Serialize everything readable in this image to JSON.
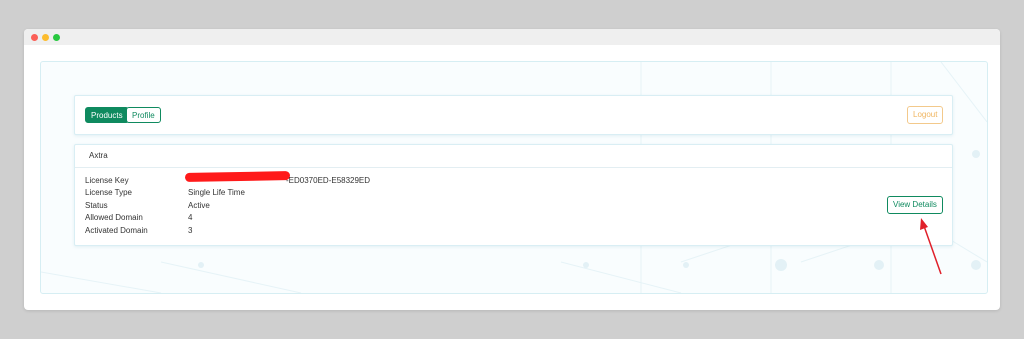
{
  "nav": {
    "products_label": "Products",
    "profile_label": "Profile",
    "logout_label": "Logout"
  },
  "license_card": {
    "title": "Axtra",
    "rows": [
      {
        "label": "License Key",
        "value": "-ED0370ED-E58329ED",
        "redacted": true
      },
      {
        "label": "License Type",
        "value": "Single Life Time"
      },
      {
        "label": "Status",
        "value": "Active"
      },
      {
        "label": "Allowed Domain",
        "value": "4"
      },
      {
        "label": "Activated Domain",
        "value": "3"
      }
    ],
    "details_label": "View Details"
  },
  "colors": {
    "primary": "#0f8a5f",
    "logout": "#f0b560",
    "redaction": "#ff1a1a",
    "annotation_arrow": "#e0202a"
  },
  "icons": [
    "close-dot",
    "minimize-dot",
    "maximize-dot",
    "annotation-arrow"
  ]
}
